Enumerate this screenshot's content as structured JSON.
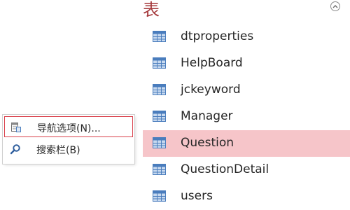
{
  "nav_pane": {
    "group_title": "表",
    "collapse_icon": "chevron-up-circle-icon",
    "tables": [
      {
        "label": "dtproperties",
        "icon": "table-icon",
        "selected": false
      },
      {
        "label": "HelpBoard",
        "icon": "table-icon",
        "selected": false
      },
      {
        "label": "jckeyword",
        "icon": "table-icon",
        "selected": false
      },
      {
        "label": "Manager",
        "icon": "table-icon",
        "selected": false
      },
      {
        "label": "Question",
        "icon": "table-icon",
        "selected": true
      },
      {
        "label": "QuestionDetail",
        "icon": "table-icon",
        "selected": false
      },
      {
        "label": "users",
        "icon": "table-icon",
        "selected": false
      }
    ]
  },
  "context_menu": {
    "items": [
      {
        "label": "导航选项(N)...",
        "icon": "navigation-options-icon",
        "highlighted": true
      },
      {
        "label": "搜索栏(B)",
        "icon": "search-icon",
        "highlighted": false
      }
    ]
  },
  "colors": {
    "group_title": "#a4373a",
    "selected_row": "#f6c5c9",
    "highlight_border": "#d9404b",
    "table_icon_header": "#4a7dbd",
    "table_icon_cells": "#c7d9ef"
  }
}
